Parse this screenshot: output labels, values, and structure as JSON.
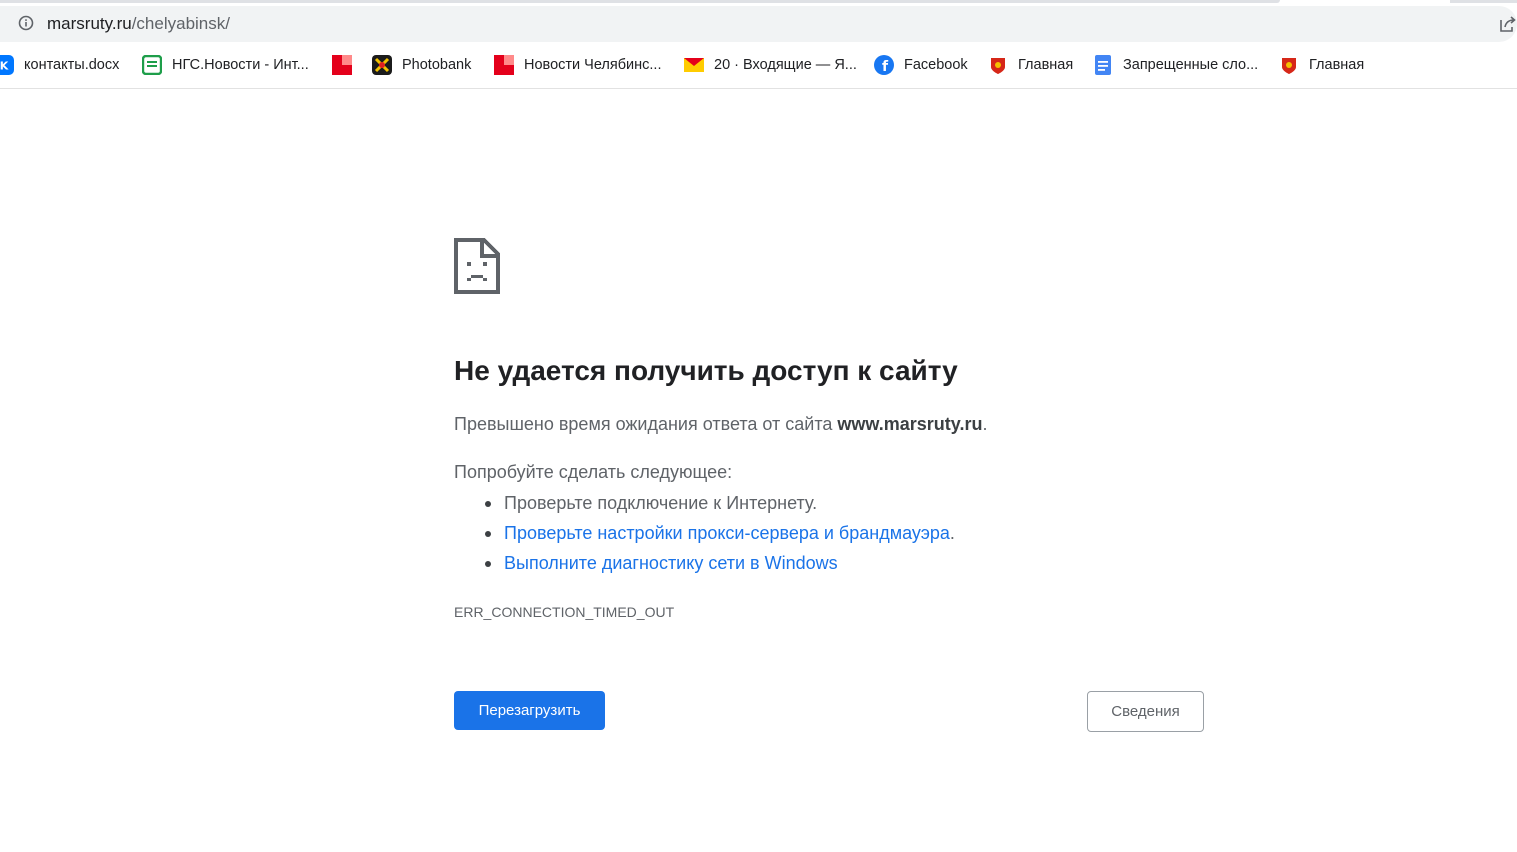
{
  "browser": {
    "address_bar": {
      "host": "marsruty.ru",
      "path": "/chelyabinsk/"
    },
    "bookmarks": [
      {
        "label": "контакты.docx",
        "icon": "vk-icon"
      },
      {
        "label": "НГС.Новости - Инт...",
        "icon": "ngs-icon"
      },
      {
        "label": "",
        "icon": "red-square-icon"
      },
      {
        "label": "Photobank",
        "icon": "photobank-icon"
      },
      {
        "label": "Новости Челябинс...",
        "icon": "red-square-icon"
      },
      {
        "label": "20 · Входящие — Я...",
        "icon": "mail-icon"
      },
      {
        "label": "Facebook",
        "icon": "facebook-icon"
      },
      {
        "label": "Главная",
        "icon": "emblem-icon"
      },
      {
        "label": "Запрещенные сло...",
        "icon": "docs-icon"
      },
      {
        "label": "Главная",
        "icon": "emblem-icon"
      }
    ]
  },
  "error_page": {
    "title": "Не удается получить доступ к сайту",
    "subtitle_prefix": "Превышено время ожидания ответа от сайта ",
    "subtitle_host": "www.marsruty.ru",
    "subtitle_suffix": ".",
    "try_text": "Попробуйте сделать следующее:",
    "suggestions": [
      {
        "text": "Проверьте подключение к Интернету.",
        "link": false
      },
      {
        "text": "Проверьте настройки прокси-сервера и брандмауэра",
        "link": true,
        "suffix": "."
      },
      {
        "text": "Выполните диагностику сети в Windows",
        "link": true,
        "suffix": ""
      }
    ],
    "error_code": "ERR_CONNECTION_TIMED_OUT",
    "reload_label": "Перезагрузить",
    "details_label": "Сведения"
  },
  "colors": {
    "link": "#1a73e8",
    "primary_button": "#1a73e8",
    "text_secondary": "#5f6368"
  }
}
